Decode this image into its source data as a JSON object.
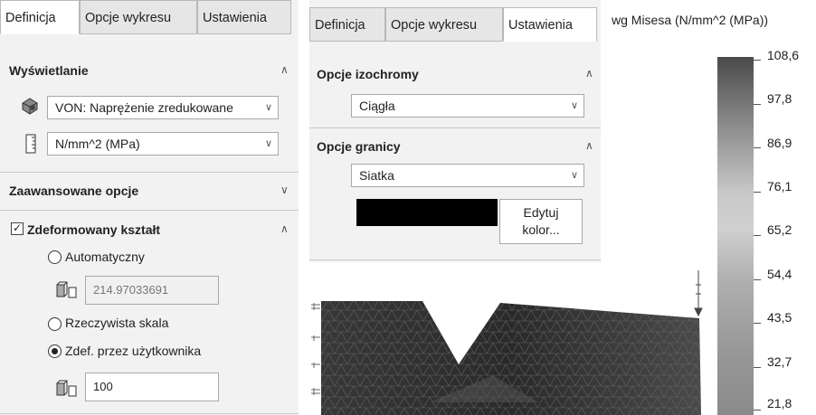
{
  "left_panel": {
    "tabs": [
      "Definicja",
      "Opcje wykresu",
      "Ustawienia"
    ],
    "display_title": "Wyświetlanie",
    "stress_select": "VON: Naprężenie zredukowane",
    "unit_select": "N/mm^2 (MPa)",
    "advanced_title": "Zaawansowane opcje",
    "deformed_title": "Zdeformowany kształt",
    "deformed_checked": true,
    "radio_auto": "Automatyczny",
    "auto_value": "214.97033691",
    "radio_real": "Rzeczywista skala",
    "radio_user": "Zdef. przez użytkownika",
    "selected_radio": "Zdef. przez użytkownika",
    "user_value": "100"
  },
  "right_panel": {
    "tabs": [
      "Definicja",
      "Opcje wykresu",
      "Ustawienia"
    ],
    "active_tab": "Ustawienia",
    "iso_title": "Opcje izochromy",
    "iso_select": "Ciągła",
    "boundary_title": "Opcje granicy",
    "boundary_select": "Siatka",
    "edit_color_label": "Edytuj\nkolor...",
    "boundary_color": "#000000"
  },
  "legend": {
    "title": "wg Misesa (N/mm^2 (MPa))",
    "ticks": [
      "108,6",
      "97,8",
      "86,9",
      "76,1",
      "65,2",
      "54,4",
      "43,5",
      "32,7",
      "21,8"
    ]
  }
}
